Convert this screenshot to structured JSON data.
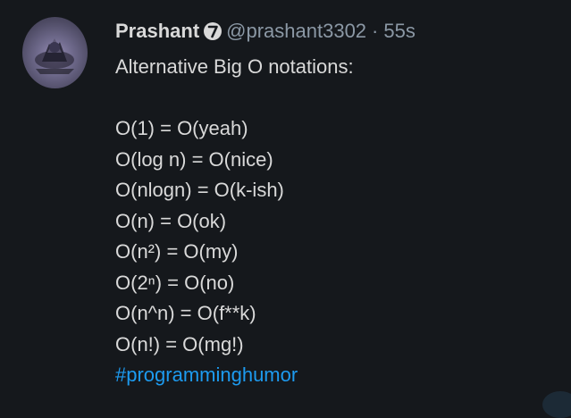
{
  "tweet": {
    "author_name": "Prashant",
    "badge_icon": "number-7-badge-icon",
    "handle": "@prashant3302",
    "separator": "·",
    "timestamp": "55s",
    "lines": [
      "Alternative Big O notations:",
      "",
      "O(1) = O(yeah)",
      "O(log n) = O(nice)",
      "O(nlogn) = O(k-ish)",
      "O(n) = O(ok)",
      "O(n²) = O(my)",
      "O(2ⁿ) = O(no)",
      "O(n^n) = O(f**k)",
      "O(n!) = O(mg!)"
    ],
    "hashtag": "#programminghumor"
  },
  "colors": {
    "background": "#15181c",
    "text": "#d9d9d9",
    "secondary": "#8b98a5",
    "link": "#1d9bf0"
  }
}
